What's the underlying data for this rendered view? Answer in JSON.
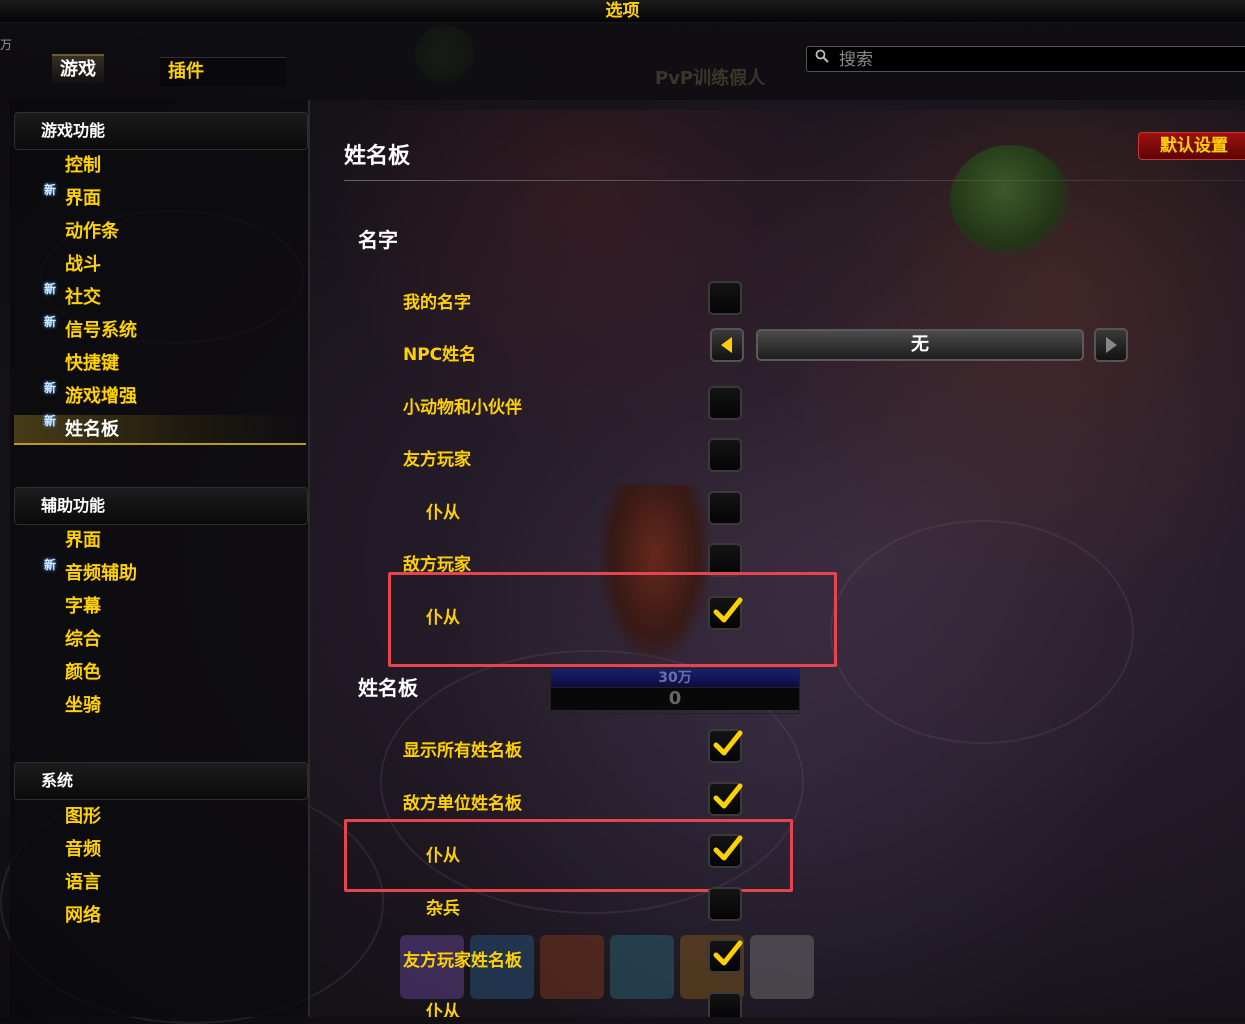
{
  "window": {
    "title": "选项"
  },
  "tabs": [
    {
      "label": "游戏"
    },
    {
      "label": "插件"
    }
  ],
  "search": {
    "placeholder": "搜索"
  },
  "background_text": {
    "target_name": "PvP训练假人",
    "edge_glyph": "万"
  },
  "sidebar": {
    "sections": [
      {
        "header": "游戏功能",
        "items": [
          {
            "label": "控制",
            "new": false
          },
          {
            "label": "界面",
            "new": true
          },
          {
            "label": "动作条",
            "new": false
          },
          {
            "label": "战斗",
            "new": false
          },
          {
            "label": "社交",
            "new": true
          },
          {
            "label": "信号系统",
            "new": true
          },
          {
            "label": "快捷键",
            "new": false
          },
          {
            "label": "游戏增强",
            "new": true
          },
          {
            "label": "姓名板",
            "new": true,
            "selected": true
          }
        ]
      },
      {
        "header": "辅助功能",
        "items": [
          {
            "label": "界面",
            "new": false
          },
          {
            "label": "音频辅助",
            "new": true
          },
          {
            "label": "字幕",
            "new": false
          },
          {
            "label": "综合",
            "new": false
          },
          {
            "label": "颜色",
            "new": false
          },
          {
            "label": "坐骑",
            "new": false
          }
        ]
      },
      {
        "header": "系统",
        "items": [
          {
            "label": "图形",
            "new": false
          },
          {
            "label": "音频",
            "new": false
          },
          {
            "label": "语言",
            "new": false
          },
          {
            "label": "网络",
            "new": false
          }
        ]
      }
    ],
    "new_badge": "新"
  },
  "content": {
    "title": "姓名板",
    "default_button": "默认设置",
    "groups": {
      "names": {
        "title": "名字",
        "options": [
          {
            "label": "我的名字",
            "checked": false
          },
          {
            "label": "NPC姓名",
            "type": "dropdown",
            "value": "无"
          },
          {
            "label": "小动物和小伙伴",
            "checked": false
          },
          {
            "label": "友方玩家",
            "checked": false
          },
          {
            "label": "仆从",
            "checked": false,
            "indent": true
          },
          {
            "label": "敌方玩家",
            "checked": false
          },
          {
            "label": "仆从",
            "checked": true,
            "indent": true,
            "highlighted": true
          }
        ]
      },
      "nameplates": {
        "title": "姓名板",
        "options": [
          {
            "label": "显示所有姓名板",
            "checked": true
          },
          {
            "label": "敌方单位姓名板",
            "checked": true
          },
          {
            "label": "仆从",
            "checked": true,
            "indent": true,
            "highlighted": true
          },
          {
            "label": "杂兵",
            "checked": false,
            "indent": true
          },
          {
            "label": "友方玩家姓名板",
            "checked": true
          },
          {
            "label": "仆从",
            "checked": false,
            "indent": true,
            "partial": true
          }
        ]
      }
    },
    "statbar": {
      "top": "30万",
      "bottom": "0"
    }
  },
  "colors": {
    "gold": "#ffd100",
    "highlight": "#e64550",
    "default_button": "#a01010"
  }
}
